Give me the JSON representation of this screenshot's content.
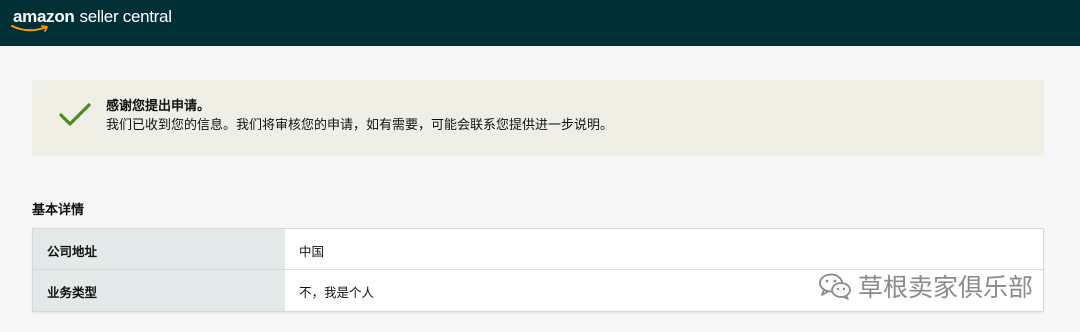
{
  "header": {
    "logo_brand": "amazon",
    "logo_rest": "seller central"
  },
  "banner": {
    "icon": "check-icon",
    "title": "感谢您提出申请。",
    "message": "我们已收到您的信息。我们将审核您的申请，如有需要，可能会联系您提供进一步说明。"
  },
  "details": {
    "section_title": "基本详情",
    "rows": [
      {
        "label": "公司地址",
        "value": "中国"
      },
      {
        "label": "业务类型",
        "value": "不，我是个人"
      }
    ]
  },
  "watermark": {
    "icon": "wechat-icon",
    "text": "草根卖家俱乐部"
  },
  "colors": {
    "topbar": "#002f36",
    "banner_bg": "#efefe6",
    "check": "#4d8a1d",
    "label_bg": "#e3eaea",
    "smile": "#ff9900"
  }
}
